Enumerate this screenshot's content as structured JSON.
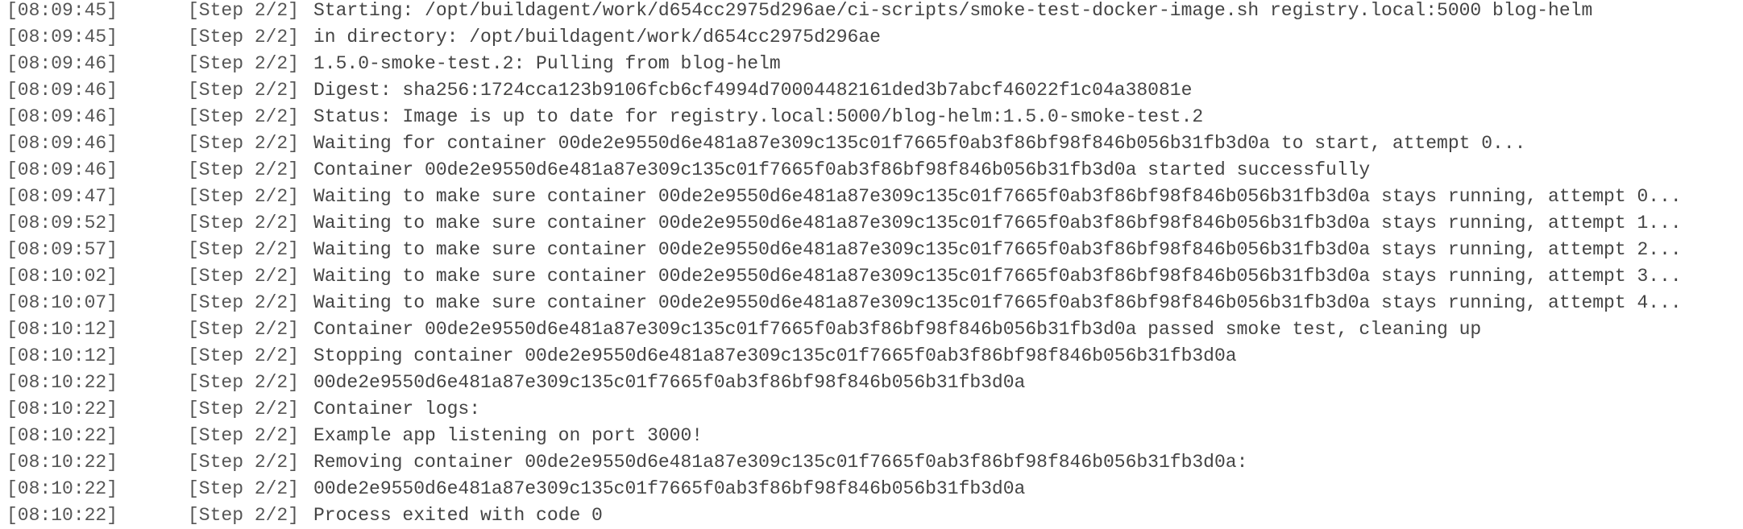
{
  "log": {
    "lines": [
      {
        "timestamp": "[08:09:45]",
        "step": "[Step 2/2]",
        "message": "Starting: /opt/buildagent/work/d654cc2975d296ae/ci-scripts/smoke-test-docker-image.sh registry.local:5000 blog-helm"
      },
      {
        "timestamp": "[08:09:45]",
        "step": "[Step 2/2]",
        "message": "in directory: /opt/buildagent/work/d654cc2975d296ae"
      },
      {
        "timestamp": "[08:09:46]",
        "step": "[Step 2/2]",
        "message": "1.5.0-smoke-test.2: Pulling from blog-helm"
      },
      {
        "timestamp": "[08:09:46]",
        "step": "[Step 2/2]",
        "message": "Digest: sha256:1724cca123b9106fcb6cf4994d70004482161ded3b7abcf46022f1c04a38081e"
      },
      {
        "timestamp": "[08:09:46]",
        "step": "[Step 2/2]",
        "message": "Status: Image is up to date for registry.local:5000/blog-helm:1.5.0-smoke-test.2"
      },
      {
        "timestamp": "[08:09:46]",
        "step": "[Step 2/2]",
        "message": "Waiting for container 00de2e9550d6e481a87e309c135c01f7665f0ab3f86bf98f846b056b31fb3d0a to start, attempt 0..."
      },
      {
        "timestamp": "[08:09:46]",
        "step": "[Step 2/2]",
        "message": "Container 00de2e9550d6e481a87e309c135c01f7665f0ab3f86bf98f846b056b31fb3d0a started successfully"
      },
      {
        "timestamp": "[08:09:47]",
        "step": "[Step 2/2]",
        "message": "Waiting to make sure container 00de2e9550d6e481a87e309c135c01f7665f0ab3f86bf98f846b056b31fb3d0a stays running, attempt 0..."
      },
      {
        "timestamp": "[08:09:52]",
        "step": "[Step 2/2]",
        "message": "Waiting to make sure container 00de2e9550d6e481a87e309c135c01f7665f0ab3f86bf98f846b056b31fb3d0a stays running, attempt 1..."
      },
      {
        "timestamp": "[08:09:57]",
        "step": "[Step 2/2]",
        "message": "Waiting to make sure container 00de2e9550d6e481a87e309c135c01f7665f0ab3f86bf98f846b056b31fb3d0a stays running, attempt 2..."
      },
      {
        "timestamp": "[08:10:02]",
        "step": "[Step 2/2]",
        "message": "Waiting to make sure container 00de2e9550d6e481a87e309c135c01f7665f0ab3f86bf98f846b056b31fb3d0a stays running, attempt 3..."
      },
      {
        "timestamp": "[08:10:07]",
        "step": "[Step 2/2]",
        "message": "Waiting to make sure container 00de2e9550d6e481a87e309c135c01f7665f0ab3f86bf98f846b056b31fb3d0a stays running, attempt 4..."
      },
      {
        "timestamp": "[08:10:12]",
        "step": "[Step 2/2]",
        "message": "Container 00de2e9550d6e481a87e309c135c01f7665f0ab3f86bf98f846b056b31fb3d0a passed smoke test, cleaning up"
      },
      {
        "timestamp": "[08:10:12]",
        "step": "[Step 2/2]",
        "message": "Stopping container 00de2e9550d6e481a87e309c135c01f7665f0ab3f86bf98f846b056b31fb3d0a"
      },
      {
        "timestamp": "[08:10:22]",
        "step": "[Step 2/2]",
        "message": "00de2e9550d6e481a87e309c135c01f7665f0ab3f86bf98f846b056b31fb3d0a"
      },
      {
        "timestamp": "[08:10:22]",
        "step": "[Step 2/2]",
        "message": "Container logs:"
      },
      {
        "timestamp": "[08:10:22]",
        "step": "[Step 2/2]",
        "message": "Example app listening on port 3000!"
      },
      {
        "timestamp": "[08:10:22]",
        "step": "[Step 2/2]",
        "message": "Removing container 00de2e9550d6e481a87e309c135c01f7665f0ab3f86bf98f846b056b31fb3d0a:"
      },
      {
        "timestamp": "[08:10:22]",
        "step": "[Step 2/2]",
        "message": "00de2e9550d6e481a87e309c135c01f7665f0ab3f86bf98f846b056b31fb3d0a"
      },
      {
        "timestamp": "[08:10:22]",
        "step": "[Step 2/2]",
        "message": "Process exited with code 0"
      }
    ]
  }
}
